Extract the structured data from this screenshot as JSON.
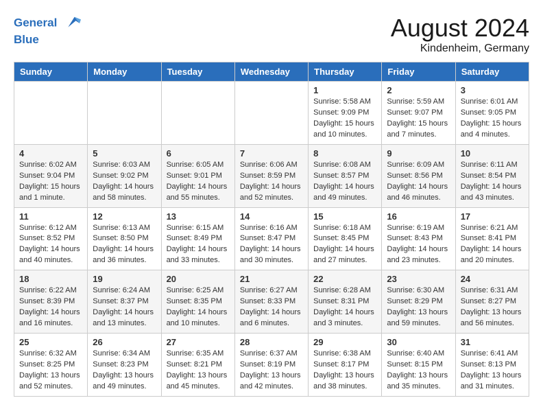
{
  "header": {
    "logo_line1": "General",
    "logo_line2": "Blue",
    "main_title": "August 2024",
    "subtitle": "Kindenheim, Germany"
  },
  "weekdays": [
    "Sunday",
    "Monday",
    "Tuesday",
    "Wednesday",
    "Thursday",
    "Friday",
    "Saturday"
  ],
  "weeks": [
    [
      {
        "day": "",
        "info": ""
      },
      {
        "day": "",
        "info": ""
      },
      {
        "day": "",
        "info": ""
      },
      {
        "day": "",
        "info": ""
      },
      {
        "day": "1",
        "info": "Sunrise: 5:58 AM\nSunset: 9:09 PM\nDaylight: 15 hours\nand 10 minutes."
      },
      {
        "day": "2",
        "info": "Sunrise: 5:59 AM\nSunset: 9:07 PM\nDaylight: 15 hours\nand 7 minutes."
      },
      {
        "day": "3",
        "info": "Sunrise: 6:01 AM\nSunset: 9:05 PM\nDaylight: 15 hours\nand 4 minutes."
      }
    ],
    [
      {
        "day": "4",
        "info": "Sunrise: 6:02 AM\nSunset: 9:04 PM\nDaylight: 15 hours\nand 1 minute."
      },
      {
        "day": "5",
        "info": "Sunrise: 6:03 AM\nSunset: 9:02 PM\nDaylight: 14 hours\nand 58 minutes."
      },
      {
        "day": "6",
        "info": "Sunrise: 6:05 AM\nSunset: 9:01 PM\nDaylight: 14 hours\nand 55 minutes."
      },
      {
        "day": "7",
        "info": "Sunrise: 6:06 AM\nSunset: 8:59 PM\nDaylight: 14 hours\nand 52 minutes."
      },
      {
        "day": "8",
        "info": "Sunrise: 6:08 AM\nSunset: 8:57 PM\nDaylight: 14 hours\nand 49 minutes."
      },
      {
        "day": "9",
        "info": "Sunrise: 6:09 AM\nSunset: 8:56 PM\nDaylight: 14 hours\nand 46 minutes."
      },
      {
        "day": "10",
        "info": "Sunrise: 6:11 AM\nSunset: 8:54 PM\nDaylight: 14 hours\nand 43 minutes."
      }
    ],
    [
      {
        "day": "11",
        "info": "Sunrise: 6:12 AM\nSunset: 8:52 PM\nDaylight: 14 hours\nand 40 minutes."
      },
      {
        "day": "12",
        "info": "Sunrise: 6:13 AM\nSunset: 8:50 PM\nDaylight: 14 hours\nand 36 minutes."
      },
      {
        "day": "13",
        "info": "Sunrise: 6:15 AM\nSunset: 8:49 PM\nDaylight: 14 hours\nand 33 minutes."
      },
      {
        "day": "14",
        "info": "Sunrise: 6:16 AM\nSunset: 8:47 PM\nDaylight: 14 hours\nand 30 minutes."
      },
      {
        "day": "15",
        "info": "Sunrise: 6:18 AM\nSunset: 8:45 PM\nDaylight: 14 hours\nand 27 minutes."
      },
      {
        "day": "16",
        "info": "Sunrise: 6:19 AM\nSunset: 8:43 PM\nDaylight: 14 hours\nand 23 minutes."
      },
      {
        "day": "17",
        "info": "Sunrise: 6:21 AM\nSunset: 8:41 PM\nDaylight: 14 hours\nand 20 minutes."
      }
    ],
    [
      {
        "day": "18",
        "info": "Sunrise: 6:22 AM\nSunset: 8:39 PM\nDaylight: 14 hours\nand 16 minutes."
      },
      {
        "day": "19",
        "info": "Sunrise: 6:24 AM\nSunset: 8:37 PM\nDaylight: 14 hours\nand 13 minutes."
      },
      {
        "day": "20",
        "info": "Sunrise: 6:25 AM\nSunset: 8:35 PM\nDaylight: 14 hours\nand 10 minutes."
      },
      {
        "day": "21",
        "info": "Sunrise: 6:27 AM\nSunset: 8:33 PM\nDaylight: 14 hours\nand 6 minutes."
      },
      {
        "day": "22",
        "info": "Sunrise: 6:28 AM\nSunset: 8:31 PM\nDaylight: 14 hours\nand 3 minutes."
      },
      {
        "day": "23",
        "info": "Sunrise: 6:30 AM\nSunset: 8:29 PM\nDaylight: 13 hours\nand 59 minutes."
      },
      {
        "day": "24",
        "info": "Sunrise: 6:31 AM\nSunset: 8:27 PM\nDaylight: 13 hours\nand 56 minutes."
      }
    ],
    [
      {
        "day": "25",
        "info": "Sunrise: 6:32 AM\nSunset: 8:25 PM\nDaylight: 13 hours\nand 52 minutes."
      },
      {
        "day": "26",
        "info": "Sunrise: 6:34 AM\nSunset: 8:23 PM\nDaylight: 13 hours\nand 49 minutes."
      },
      {
        "day": "27",
        "info": "Sunrise: 6:35 AM\nSunset: 8:21 PM\nDaylight: 13 hours\nand 45 minutes."
      },
      {
        "day": "28",
        "info": "Sunrise: 6:37 AM\nSunset: 8:19 PM\nDaylight: 13 hours\nand 42 minutes."
      },
      {
        "day": "29",
        "info": "Sunrise: 6:38 AM\nSunset: 8:17 PM\nDaylight: 13 hours\nand 38 minutes."
      },
      {
        "day": "30",
        "info": "Sunrise: 6:40 AM\nSunset: 8:15 PM\nDaylight: 13 hours\nand 35 minutes."
      },
      {
        "day": "31",
        "info": "Sunrise: 6:41 AM\nSunset: 8:13 PM\nDaylight: 13 hours\nand 31 minutes."
      }
    ]
  ]
}
